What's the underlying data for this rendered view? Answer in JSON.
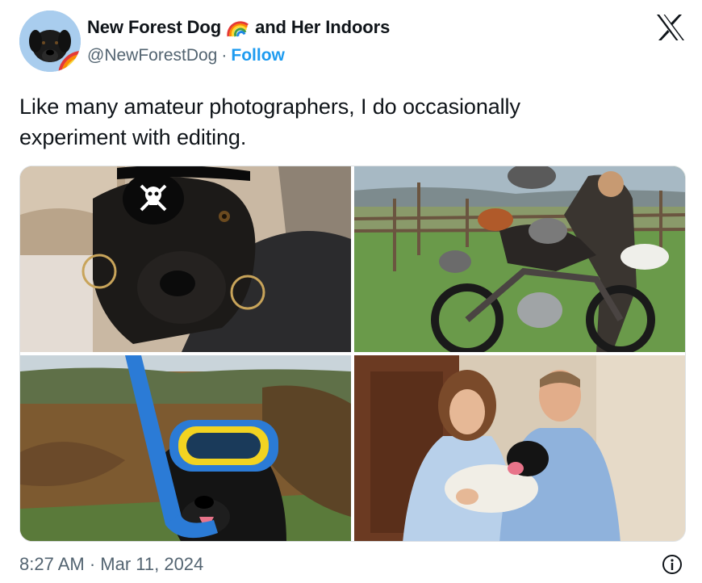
{
  "tweet": {
    "author": {
      "name_part1": "New Forest Dog",
      "name_part2": "and Her Indoors",
      "handle": "@NewForestDog",
      "separator": "·",
      "follow_label": "Follow",
      "avatar_icon": "dog-avatar-icon",
      "emoji_icon": "rainbow-emoji-icon"
    },
    "text_line1": "Like many amateur photographers, I do occasionally",
    "text_line2": "experiment with editing.",
    "timestamp": "8:27 AM · Mar 11, 2024",
    "photos": [
      {
        "name": "photo-pirate-dog"
      },
      {
        "name": "photo-motorbike-chickens"
      },
      {
        "name": "photo-snorkel-dog"
      },
      {
        "name": "photo-royal-couple-dog"
      }
    ],
    "colors": {
      "follow": "#1d9bf0",
      "secondary_text": "#536471",
      "primary_text": "#0f1419"
    },
    "icons": {
      "logo": "x-logo-icon",
      "info": "info-icon"
    }
  }
}
